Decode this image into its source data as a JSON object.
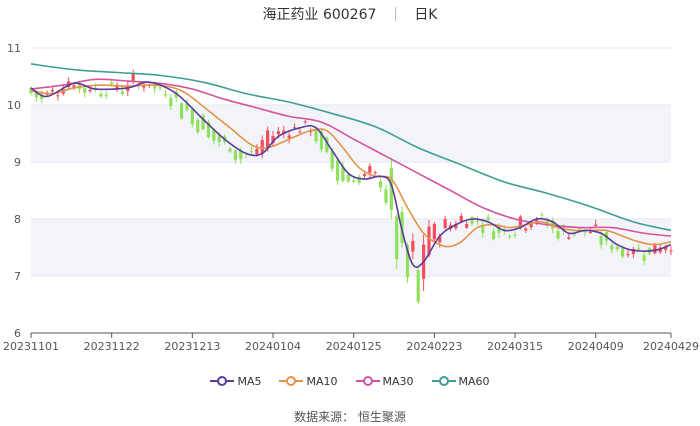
{
  "header": {
    "stock": "海正药业 600267",
    "period": "日K"
  },
  "source": "数据来源：  恒生聚源",
  "colors": {
    "up": "#f54d5c",
    "down": "#8fe05a",
    "ma5": "#5a3b9b",
    "ma10": "#e39447",
    "ma30": "#d4559e",
    "ma60": "#3e9e95",
    "band": "#f3f4fa",
    "axis": "#555555",
    "grid": "#e4e6f0"
  },
  "chart_data": {
    "type": "candlestick",
    "y_ticks": [
      "6",
      "7",
      "8",
      "9",
      "10",
      "11"
    ],
    "ylim": [
      6,
      11
    ],
    "x_ticks": [
      "20231101",
      "20231122",
      "20231213",
      "20240104",
      "20240125",
      "20240223",
      "20240315",
      "20240409",
      "20240429"
    ],
    "x_tick_index": [
      0,
      15,
      30,
      45,
      60,
      75,
      90,
      105,
      119
    ],
    "n": 120,
    "legend": [
      "MA5",
      "MA10",
      "MA30",
      "MA60"
    ],
    "ma": {
      "MA5": [
        [
          0,
          10.3
        ],
        [
          3,
          10.15
        ],
        [
          8,
          10.38
        ],
        [
          12,
          10.28
        ],
        [
          18,
          10.3
        ],
        [
          22,
          10.4
        ],
        [
          27,
          10.2
        ],
        [
          32,
          9.75
        ],
        [
          36,
          9.4
        ],
        [
          40,
          9.15
        ],
        [
          43,
          9.15
        ],
        [
          46,
          9.45
        ],
        [
          50,
          9.6
        ],
        [
          53,
          9.6
        ],
        [
          56,
          9.2
        ],
        [
          59,
          8.8
        ],
        [
          62,
          8.7
        ],
        [
          65,
          8.75
        ],
        [
          67,
          8.6
        ],
        [
          69,
          7.8
        ],
        [
          71,
          7.2
        ],
        [
          73,
          7.25
        ],
        [
          76,
          7.7
        ],
        [
          79,
          7.9
        ],
        [
          82,
          8.0
        ],
        [
          85,
          7.95
        ],
        [
          88,
          7.8
        ],
        [
          91,
          7.85
        ],
        [
          94,
          8.0
        ],
        [
          97,
          7.95
        ],
        [
          100,
          7.75
        ],
        [
          103,
          7.8
        ],
        [
          106,
          7.75
        ],
        [
          109,
          7.55
        ],
        [
          112,
          7.45
        ],
        [
          116,
          7.45
        ],
        [
          119,
          7.55
        ]
      ],
      "MA10": [
        [
          0,
          10.25
        ],
        [
          4,
          10.2
        ],
        [
          8,
          10.3
        ],
        [
          13,
          10.35
        ],
        [
          18,
          10.33
        ],
        [
          23,
          10.35
        ],
        [
          28,
          10.25
        ],
        [
          33,
          9.9
        ],
        [
          37,
          9.6
        ],
        [
          41,
          9.3
        ],
        [
          44,
          9.25
        ],
        [
          48,
          9.4
        ],
        [
          52,
          9.55
        ],
        [
          55,
          9.55
        ],
        [
          58,
          9.25
        ],
        [
          61,
          8.9
        ],
        [
          64,
          8.75
        ],
        [
          67,
          8.7
        ],
        [
          70,
          8.2
        ],
        [
          73,
          7.75
        ],
        [
          76,
          7.55
        ],
        [
          78,
          7.52
        ],
        [
          80,
          7.6
        ],
        [
          83,
          7.85
        ],
        [
          86,
          7.9
        ],
        [
          89,
          7.85
        ],
        [
          92,
          7.9
        ],
        [
          95,
          7.95
        ],
        [
          98,
          7.85
        ],
        [
          101,
          7.8
        ],
        [
          104,
          7.8
        ],
        [
          107,
          7.8
        ],
        [
          110,
          7.7
        ],
        [
          113,
          7.6
        ],
        [
          116,
          7.55
        ],
        [
          119,
          7.6
        ]
      ],
      "MA30": [
        [
          0,
          10.28
        ],
        [
          6,
          10.35
        ],
        [
          12,
          10.45
        ],
        [
          18,
          10.42
        ],
        [
          24,
          10.38
        ],
        [
          30,
          10.28
        ],
        [
          36,
          10.1
        ],
        [
          42,
          9.95
        ],
        [
          48,
          9.8
        ],
        [
          54,
          9.7
        ],
        [
          60,
          9.4
        ],
        [
          66,
          9.1
        ],
        [
          72,
          8.8
        ],
        [
          78,
          8.5
        ],
        [
          84,
          8.2
        ],
        [
          90,
          8.0
        ],
        [
          96,
          7.9
        ],
        [
          102,
          7.85
        ],
        [
          108,
          7.85
        ],
        [
          114,
          7.75
        ],
        [
          119,
          7.7
        ]
      ],
      "MA60": [
        [
          0,
          10.72
        ],
        [
          8,
          10.62
        ],
        [
          16,
          10.57
        ],
        [
          24,
          10.52
        ],
        [
          32,
          10.4
        ],
        [
          40,
          10.2
        ],
        [
          48,
          10.05
        ],
        [
          56,
          9.85
        ],
        [
          64,
          9.62
        ],
        [
          72,
          9.25
        ],
        [
          80,
          8.95
        ],
        [
          88,
          8.65
        ],
        [
          96,
          8.45
        ],
        [
          104,
          8.22
        ],
        [
          112,
          7.95
        ],
        [
          119,
          7.8
        ]
      ]
    }
  }
}
